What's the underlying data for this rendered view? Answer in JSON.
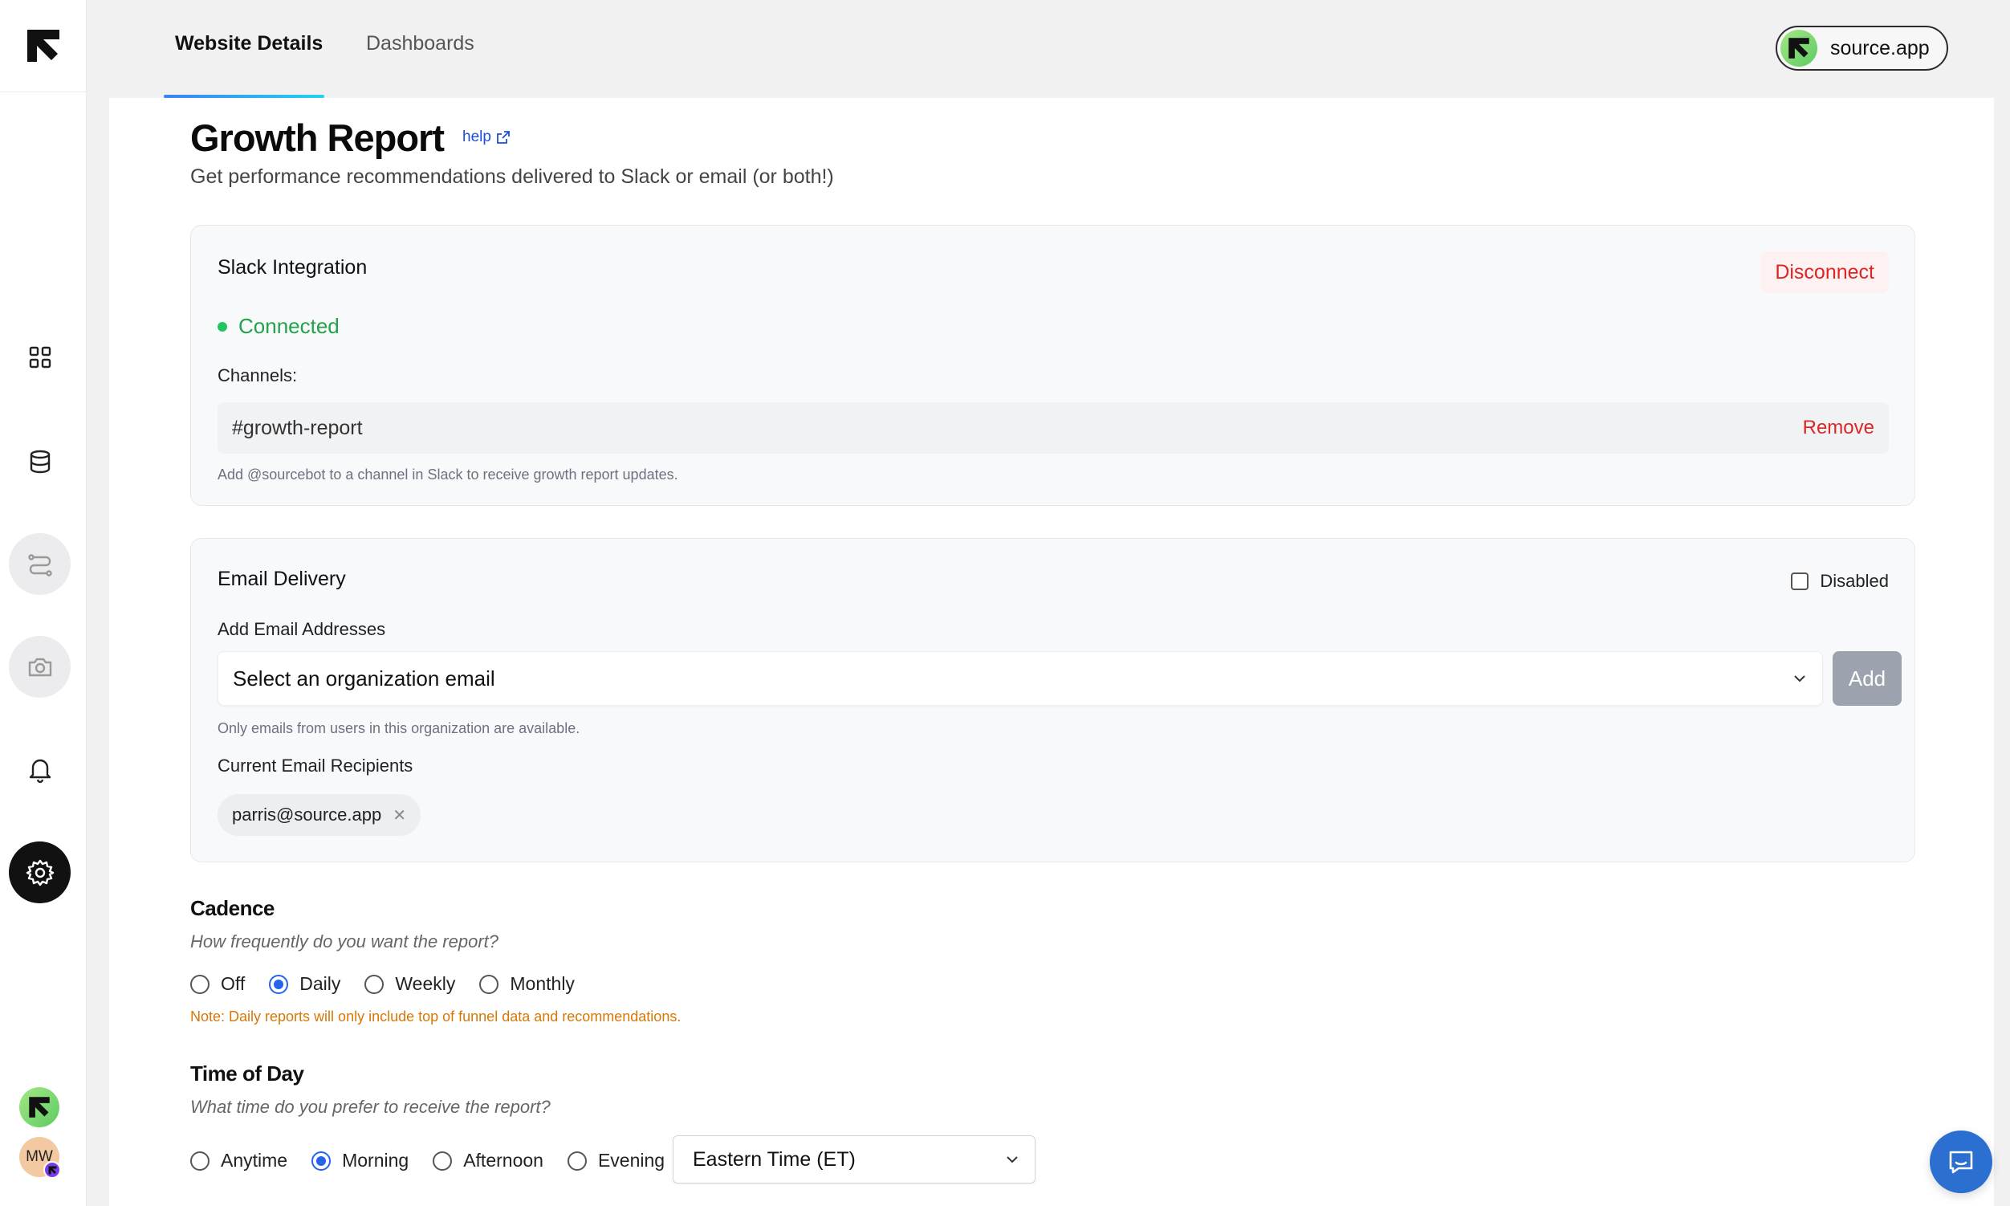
{
  "app": {
    "org_name": "source.app",
    "user_initials": "MW"
  },
  "tabs": [
    {
      "label": "Website Details",
      "active": true
    },
    {
      "label": "Dashboards",
      "active": false
    }
  ],
  "sidebar": {
    "items": [
      {
        "icon": "grid-icon"
      },
      {
        "icon": "database-icon"
      },
      {
        "icon": "route-icon"
      },
      {
        "icon": "camera-icon"
      },
      {
        "icon": "bell-icon"
      },
      {
        "icon": "gear-icon",
        "active": true
      }
    ]
  },
  "page": {
    "title": "Growth Report",
    "help_label": "help",
    "subtitle": "Get performance recommendations delivered to Slack or email (or both!)"
  },
  "slack": {
    "title": "Slack Integration",
    "disconnect_label": "Disconnect",
    "status": "Connected",
    "channels_label": "Channels:",
    "channels": [
      {
        "name": "#growth-report",
        "remove_label": "Remove"
      }
    ],
    "hint": "Add @sourcebot to a channel in Slack to receive growth report updates."
  },
  "email": {
    "title": "Email Delivery",
    "disabled_label": "Disabled",
    "add_label": "Add Email Addresses",
    "select_placeholder": "Select an organization email",
    "add_button": "Add",
    "hint": "Only emails from users in this organization are available.",
    "recipients_label": "Current Email Recipients",
    "recipients": [
      "parris@source.app"
    ]
  },
  "cadence": {
    "title": "Cadence",
    "question": "How frequently do you want the report?",
    "options": [
      "Off",
      "Daily",
      "Weekly",
      "Monthly"
    ],
    "selected": "Daily",
    "note": "Note: Daily reports will only include top of funnel data and recommendations."
  },
  "time_of_day": {
    "title": "Time of Day",
    "question": "What time do you prefer to receive the report?",
    "options": [
      "Anytime",
      "Morning",
      "Afternoon",
      "Evening"
    ],
    "selected": "Morning",
    "timezone": "Eastern Time (ET)"
  },
  "colors": {
    "accent": "#2563eb",
    "danger": "#dc2626",
    "success": "#22a34a",
    "warning": "#d97706"
  }
}
